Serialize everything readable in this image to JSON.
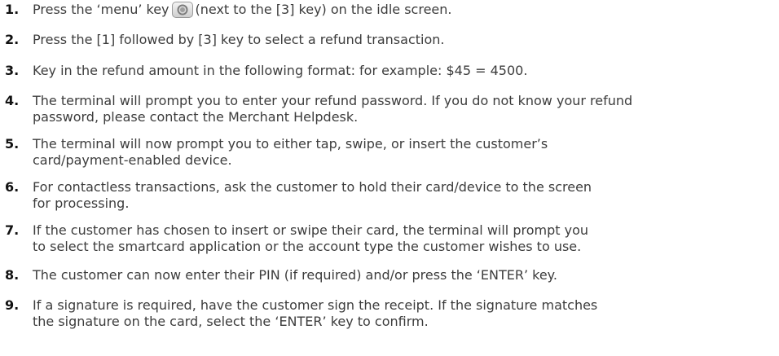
{
  "steps": [
    {
      "num": "1.",
      "before": "Press the ‘menu’ key",
      "icon": "menu-key-icon",
      "after": "(next to the [3] key) on the idle screen."
    },
    {
      "num": "2.",
      "lines": [
        "Press the [1] followed by [3]  key to select a refund transaction."
      ]
    },
    {
      "num": "3.",
      "lines": [
        "Key in the refund amount in the following format: for example: $45 = 4500."
      ]
    },
    {
      "num": "4.",
      "lines": [
        "The terminal will prompt you to enter your refund password. If you do not know your refund",
        "password, please contact the Merchant Helpdesk."
      ]
    },
    {
      "num": "5.",
      "lines": [
        "The terminal will now prompt you to either tap, swipe, or insert the customer’s",
        "card/payment-enabled device."
      ]
    },
    {
      "num": "6.",
      "lines": [
        "For contactless transactions, ask the customer to hold their card/device to the screen",
        "for processing."
      ]
    },
    {
      "num": "7.",
      "lines": [
        "If the customer has chosen to insert or swipe their card, the terminal will prompt you",
        "to select the smartcard application or the account type the customer wishes to use."
      ]
    },
    {
      "num": "8.",
      "lines": [
        "The customer can now enter their PIN (if required) and/or press the ‘ENTER’ key."
      ]
    },
    {
      "num": "9.",
      "lines": [
        "If a signature is required, have the customer sign the receipt. If the signature matches",
        "the signature on the card, select the ‘ENTER’ key to confirm."
      ]
    }
  ]
}
